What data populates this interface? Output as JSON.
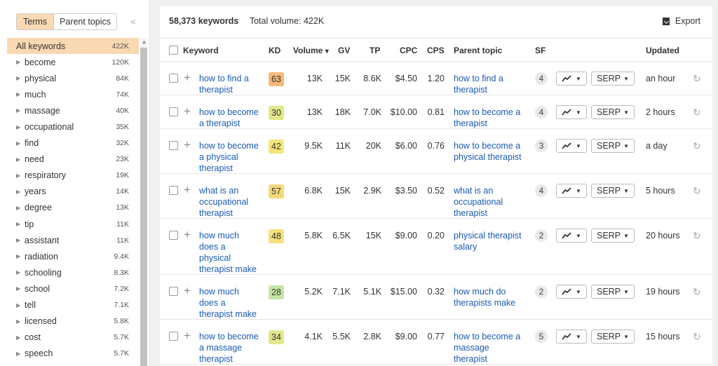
{
  "sidebar": {
    "tabs": [
      {
        "label": "Terms",
        "active": true
      },
      {
        "label": "Parent topics",
        "active": false
      }
    ],
    "collapse_glyph": "«",
    "items": [
      {
        "label": "All keywords",
        "count": "422K",
        "selected": true
      },
      {
        "label": "become",
        "count": "120K"
      },
      {
        "label": "physical",
        "count": "84K"
      },
      {
        "label": "much",
        "count": "74K"
      },
      {
        "label": "massage",
        "count": "40K"
      },
      {
        "label": "occupational",
        "count": "35K"
      },
      {
        "label": "find",
        "count": "32K"
      },
      {
        "label": "need",
        "count": "23K"
      },
      {
        "label": "respiratory",
        "count": "19K"
      },
      {
        "label": "years",
        "count": "14K"
      },
      {
        "label": "degree",
        "count": "13K"
      },
      {
        "label": "tip",
        "count": "11K"
      },
      {
        "label": "assistant",
        "count": "11K"
      },
      {
        "label": "radiation",
        "count": "9.4K"
      },
      {
        "label": "schooling",
        "count": "8.3K"
      },
      {
        "label": "school",
        "count": "7.2K"
      },
      {
        "label": "tell",
        "count": "7.1K"
      },
      {
        "label": "licensed",
        "count": "5.8K"
      },
      {
        "label": "cost",
        "count": "5.7K"
      },
      {
        "label": "speech",
        "count": "5.7K"
      }
    ]
  },
  "summary": {
    "keywords": "58,373 keywords",
    "total_volume": "Total volume: 422K"
  },
  "export_label": "Export",
  "columns": {
    "keyword": "Keyword",
    "kd": "KD",
    "volume": "Volume",
    "volume_sort": "▾",
    "gv": "GV",
    "tp": "TP",
    "cpc": "CPC",
    "cps": "CPS",
    "parent_topic": "Parent topic",
    "sf": "SF",
    "updated": "Updated"
  },
  "kd_colors": {
    "green": "#c5e5a5",
    "yellow": "#f5e67a",
    "orange": "#f7b97a",
    "accent_link": "#1a5bb5"
  },
  "serp_label": "SERP",
  "rows": [
    {
      "keyword": [
        "how to find a",
        "therapist"
      ],
      "kd": "63",
      "kd_color": "#f7b97a",
      "volume": "13K",
      "gv": "15K",
      "tp": "8.6K",
      "cpc": "$4.50",
      "cps": "1.20",
      "parent": [
        "how to find a",
        "therapist"
      ],
      "sf": "4",
      "updated": "an hour"
    },
    {
      "keyword": [
        "how to become",
        "a therapist"
      ],
      "kd": "30",
      "kd_color": "#e3e78a",
      "volume": "13K",
      "gv": "18K",
      "tp": "7.0K",
      "cpc": "$10.00",
      "cps": "0.81",
      "parent": [
        "how to become a",
        "therapist"
      ],
      "sf": "4",
      "updated": "2 hours"
    },
    {
      "keyword": [
        "how to become",
        "a physical",
        "therapist"
      ],
      "kd": "42",
      "kd_color": "#f5e67a",
      "volume": "9.5K",
      "gv": "11K",
      "tp": "20K",
      "cpc": "$6.00",
      "cps": "0.76",
      "parent": [
        "how to become a",
        "physical therapist"
      ],
      "sf": "3",
      "updated": "a day"
    },
    {
      "keyword": [
        "what is an",
        "occupational",
        "therapist"
      ],
      "kd": "57",
      "kd_color": "#f5d97a",
      "volume": "6.8K",
      "gv": "15K",
      "tp": "2.9K",
      "cpc": "$3.50",
      "cps": "0.52",
      "parent": [
        "what is an",
        "occupational",
        "therapist"
      ],
      "sf": "4",
      "updated": "5 hours"
    },
    {
      "keyword": [
        "how much",
        "does a",
        "physical",
        "therapist make"
      ],
      "kd": "48",
      "kd_color": "#f5e07a",
      "volume": "5.8K",
      "gv": "6.5K",
      "tp": "15K",
      "cpc": "$9.00",
      "cps": "0.20",
      "parent": [
        "physical therapist",
        "salary"
      ],
      "sf": "2",
      "updated": "20 hours"
    },
    {
      "keyword": [
        "how much",
        "does a",
        "therapist make"
      ],
      "kd": "28",
      "kd_color": "#c5e5a5",
      "volume": "5.2K",
      "gv": "7.1K",
      "tp": "5.1K",
      "cpc": "$15.00",
      "cps": "0.32",
      "parent": [
        "how much do",
        "therapists make"
      ],
      "sf": "2",
      "updated": "19 hours"
    },
    {
      "keyword": [
        "how to become",
        "a massage",
        "therapist"
      ],
      "kd": "34",
      "kd_color": "#e3e78a",
      "volume": "4.1K",
      "gv": "5.5K",
      "tp": "2.8K",
      "cpc": "$9.00",
      "cps": "0.77",
      "parent": [
        "how to become a",
        "massage",
        "therapist"
      ],
      "sf": "5",
      "updated": "15 hours"
    }
  ]
}
